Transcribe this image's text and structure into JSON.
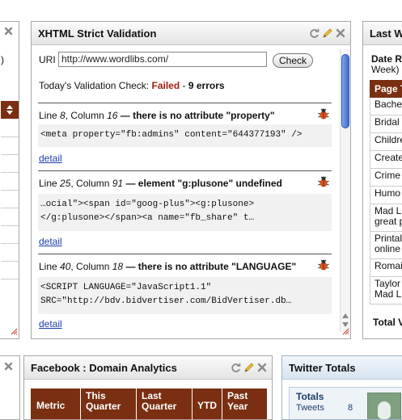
{
  "left_widget": {
    "paren": ")"
  },
  "validation": {
    "title": "XHTML Strict Validation",
    "uri_label": "URI",
    "uri_value": "http://www.wordlibs.com/",
    "check_label": "Check",
    "today_label": "Today's Validation Check: ",
    "status": "Failed",
    "sep": " - ",
    "error_count": "9 errors",
    "errors": [
      {
        "line_label": "Line ",
        "line": "8",
        "col_label": ", Column ",
        "col": "16",
        "message": " — there is no attribute \"property\"",
        "code_1": "<meta property=\"fb:admins\" content=\"644377193\" />",
        "code_2": "",
        "detail": "detail"
      },
      {
        "line_label": "Line ",
        "line": "25",
        "col_label": ", Column ",
        "col": "91",
        "message": " — element \"g:plusone\" undefined",
        "code_1": "…ocial\"><span id=\"goog-plus\"><g:plusone>",
        "code_2": "</g:plusone></span><a name=\"fb_share\" t…",
        "detail": "detail"
      },
      {
        "line_label": "Line ",
        "line": "40",
        "col_label": ", Column ",
        "col": "18",
        "message": " — there is no attribute \"LANGUAGE\"",
        "code_1": "<SCRIPT LANGUAGE=\"JavaScript1.1\"",
        "code_2": "SRC=\"http://bdv.bidvertiser.com/BidVertiser.db…",
        "detail": "detail"
      }
    ]
  },
  "right_widget": {
    "title": "Last W",
    "sub_bold": "Date R",
    "sub_normal": "Week)",
    "header": "Page T",
    "rows": [
      "Bache",
      "Bridal",
      "Childre",
      "Create",
      "Crime",
      "Humo",
      "Mad L\ngreat p",
      "Printal\nonline",
      "Romai",
      "Taylor\nMad L"
    ],
    "total": "Total V"
  },
  "facebook": {
    "title": "Facebook : Domain Analytics",
    "columns": [
      "Metric",
      "This\nQuarter",
      "Last\nQuarter",
      "YTD",
      "Past\nYear"
    ]
  },
  "twitter": {
    "title": "Twitter Totals",
    "totals_label": "Totals",
    "tweets_label": "Tweets",
    "tweets_value": "8"
  },
  "colors": {
    "accent_header": "#7a2f12",
    "failed": "#a11e10",
    "link": "#1b3faa"
  }
}
